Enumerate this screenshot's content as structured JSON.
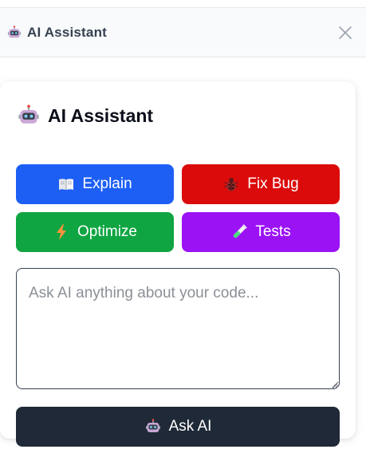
{
  "header": {
    "title": "AI Assistant",
    "icon": "robot-icon",
    "close_icon": "close-icon"
  },
  "card": {
    "title": "AI Assistant",
    "icon": "robot-icon"
  },
  "actions": [
    {
      "label": "Explain",
      "icon": "book-icon",
      "color": "#1d5ff5"
    },
    {
      "label": "Fix Bug",
      "icon": "bug-icon",
      "color": "#dc0b0b"
    },
    {
      "label": "Optimize",
      "icon": "lightning-icon",
      "color": "#0ea542"
    },
    {
      "label": "Tests",
      "icon": "test-tube-icon",
      "color": "#9b12f5"
    }
  ],
  "prompt": {
    "placeholder": "Ask AI anything about your code...",
    "value": ""
  },
  "ask_button": {
    "label": "Ask AI",
    "icon": "robot-icon",
    "color": "#1f2937"
  }
}
